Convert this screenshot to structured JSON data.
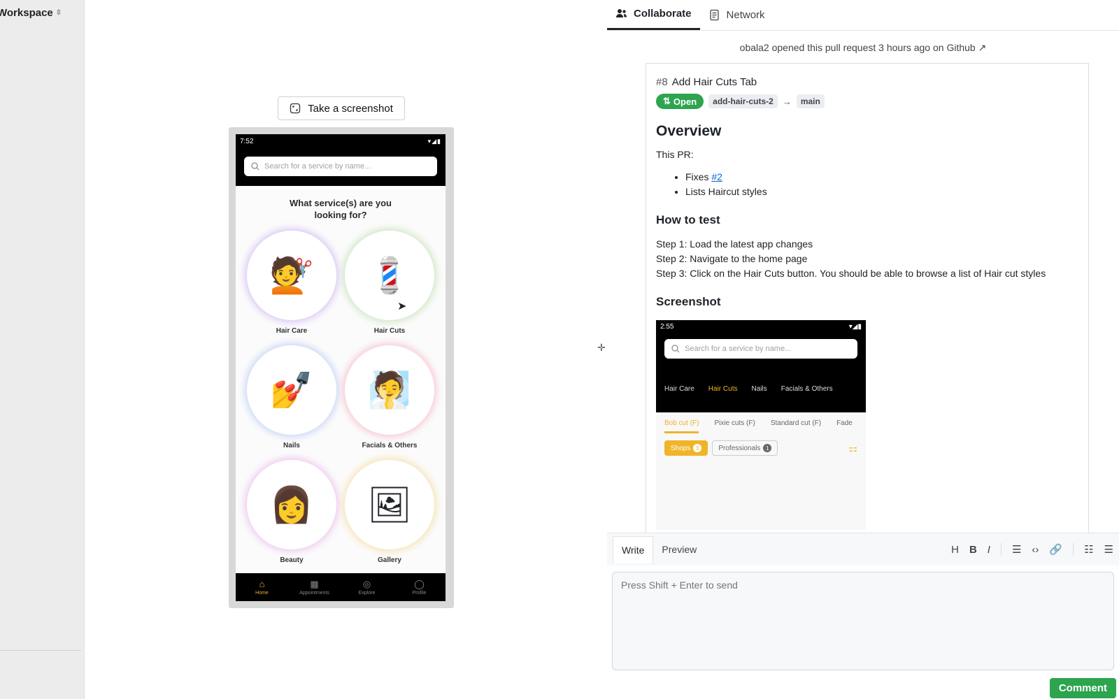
{
  "sidebar": {
    "workspace_label": "Workspace",
    "updown_icon": "⇳"
  },
  "preview": {
    "screenshot_button": "Take a screenshot",
    "phone": {
      "time": "7:52",
      "status_icons": "▾◢▮",
      "search_placeholder": "Search for a service by name...",
      "question": "What service(s) are you looking for?",
      "tiles": [
        {
          "label": "Hair Care",
          "icon": "💇",
          "ring": "#d9c7f5"
        },
        {
          "label": "Hair Cuts",
          "icon": "💈",
          "ring": "#cfe6c6"
        },
        {
          "label": "Nails",
          "icon": "💅",
          "ring": "#c9d7f5"
        },
        {
          "label": "Facials & Others",
          "icon": "🧖",
          "ring": "#f6c9d2"
        },
        {
          "label": "Beauty",
          "icon": "👩",
          "ring": "#eec9f0"
        },
        {
          "label": "Gallery",
          "icon": "🖼",
          "ring": "#f6e4b8"
        }
      ],
      "nav": [
        {
          "label": "Home",
          "icon": "⌂"
        },
        {
          "label": "Appointments",
          "icon": "▦"
        },
        {
          "label": "Explore",
          "icon": "◎"
        },
        {
          "label": "Profile",
          "icon": "◯"
        }
      ]
    }
  },
  "panel": {
    "tabs": {
      "collaborate": "Collaborate",
      "network": "Network"
    },
    "opened_text": "obala2 opened this pull request 3 hours ago on Github ↗",
    "pr": {
      "number": "#8",
      "title": "Add Hair Cuts Tab",
      "status": "Open",
      "head_branch": "add-hair-cuts-2",
      "arrow": "→",
      "base_branch": "main",
      "overview_heading": "Overview",
      "intro": "This PR:",
      "bullet_fixes_prefix": "Fixes ",
      "bullet_fixes_link": "#2",
      "bullet_2": "Lists Haircut styles",
      "howto_heading": "How to test",
      "steps": [
        "Step 1: Load the latest app changes",
        "Step 2: Navigate to the home page",
        "Step 3: Click on the Hair Cuts button. You should be able to browse a list of Hair cut styles"
      ],
      "screenshot_heading": "Screenshot",
      "embed": {
        "time": "2:55",
        "search_placeholder": "Search for a service by name...",
        "categories": [
          "Hair Care",
          "Hair Cuts",
          "Nails",
          "Facials & Others"
        ],
        "subtabs": [
          "Bob cut (F)",
          "Pixie cuts (F)",
          "Standard cut (F)",
          "Fade"
        ],
        "chip_shops": "Shops",
        "chip_shops_count": "0",
        "chip_professionals": "Professionals",
        "chip_professionals_count": "1"
      }
    },
    "composer": {
      "write": "Write",
      "preview": "Preview",
      "placeholder": "Press Shift + Enter to send",
      "comment": "Comment",
      "toolbar": {
        "heading": "H",
        "bold": "B",
        "italic": "I",
        "quote": "☰",
        "code": "‹›",
        "link": "🔗",
        "ul": "☷",
        "ol": "☰"
      }
    }
  }
}
